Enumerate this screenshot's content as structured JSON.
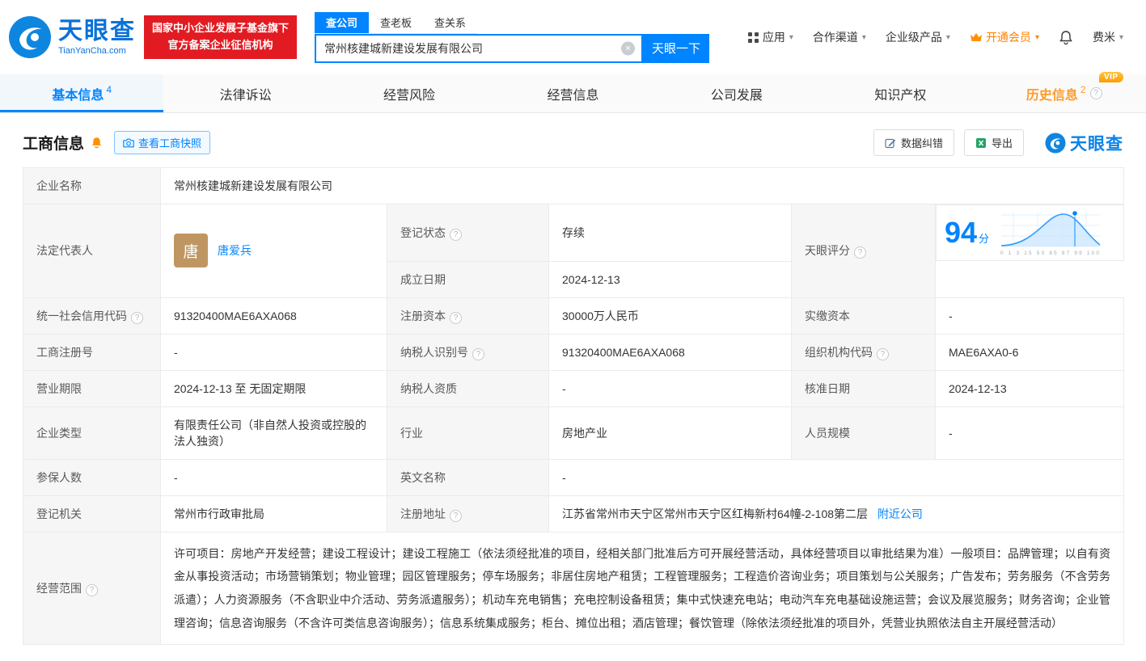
{
  "brand": {
    "name": "天眼查",
    "domain": "TianYanCha.com",
    "badge_line1": "国家中小企业发展子基金旗下",
    "badge_line2": "官方备案企业征信机构"
  },
  "icons": {
    "question": "?",
    "clear": "×",
    "caret": "▾"
  },
  "search": {
    "tabs": [
      {
        "label": "查公司"
      },
      {
        "label": "查老板"
      },
      {
        "label": "查关系"
      }
    ],
    "value": "常州核建城新建设发展有限公司",
    "button": "天眼一下"
  },
  "nav": {
    "app": "应用",
    "coop": "合作渠道",
    "enterprise": "企业级产品",
    "vip": "开通会员",
    "user": "费米"
  },
  "tabs": [
    {
      "label": "基本信息",
      "count": "4"
    },
    {
      "label": "法律诉讼"
    },
    {
      "label": "经营风险"
    },
    {
      "label": "经营信息"
    },
    {
      "label": "公司发展"
    },
    {
      "label": "知识产权"
    },
    {
      "label": "历史信息",
      "count": "2",
      "badge": "VIP"
    }
  ],
  "section": {
    "title": "工商信息",
    "snapshot": "查看工商快照",
    "correct": "数据纠错",
    "export": "导出",
    "watermark": "天眼查"
  },
  "fields": {
    "company_name": {
      "label": "企业名称",
      "value": "常州核建城新建设发展有限公司"
    },
    "legal_rep": {
      "label": "法定代表人",
      "avatar": "唐",
      "name": "唐爱兵"
    },
    "reg_status": {
      "label": "登记状态",
      "value": "存续"
    },
    "establish_date": {
      "label": "成立日期",
      "value": "2024-12-13"
    },
    "score": {
      "label": "天眼评分",
      "value": "94",
      "unit": "分",
      "axis": "0 1 3 15 50 85 97 99 100"
    },
    "credit_code": {
      "label": "统一社会信用代码",
      "value": "91320400MAE6AXA068"
    },
    "reg_capital": {
      "label": "注册资本",
      "value": "30000万人民币"
    },
    "paid_capital": {
      "label": "实缴资本",
      "value": "-"
    },
    "reg_number": {
      "label": "工商注册号",
      "value": "-"
    },
    "taxpayer_id": {
      "label": "纳税人识别号",
      "value": "91320400MAE6AXA068"
    },
    "org_code": {
      "label": "组织机构代码",
      "value": "MAE6AXA0-6"
    },
    "term": {
      "label": "营业期限",
      "value": "2024-12-13 至 无固定期限"
    },
    "taxpayer_quality": {
      "label": "纳税人资质",
      "value": "-"
    },
    "approval_date": {
      "label": "核准日期",
      "value": "2024-12-13"
    },
    "company_type": {
      "label": "企业类型",
      "value": "有限责任公司（非自然人投资或控股的法人独资）"
    },
    "industry": {
      "label": "行业",
      "value": "房地产业"
    },
    "staff": {
      "label": "人员规模",
      "value": "-"
    },
    "insured": {
      "label": "参保人数",
      "value": "-"
    },
    "english_name": {
      "label": "英文名称",
      "value": "-"
    },
    "authority": {
      "label": "登记机关",
      "value": "常州市行政审批局"
    },
    "address": {
      "label": "注册地址",
      "value": "江苏省常州市天宁区常州市天宁区红梅新村64幢-2-108第二层",
      "link": "附近公司"
    },
    "scope": {
      "label": "经营范围",
      "value": "许可项目：房地产开发经营；建设工程设计；建设工程施工（依法须经批准的项目，经相关部门批准后方可开展经营活动，具体经营项目以审批结果为准）一般项目：品牌管理；以自有资金从事投资活动；市场营销策划；物业管理；园区管理服务；停车场服务；非居住房地产租赁；工程管理服务；工程造价咨询业务；项目策划与公关服务；广告发布；劳务服务（不含劳务派遣）；人力资源服务（不含职业中介活动、劳务派遣服务）；机动车充电销售；充电控制设备租赁；集中式快速充电站；电动汽车充电基础设施运营；会议及展览服务；财务咨询；企业管理咨询；信息咨询服务（不含许可类信息咨询服务）；信息系统集成服务；柜台、摊位出租；酒店管理；餐饮管理（除依法须经批准的项目外，凭营业执照依法自主开展经营活动）"
    }
  }
}
